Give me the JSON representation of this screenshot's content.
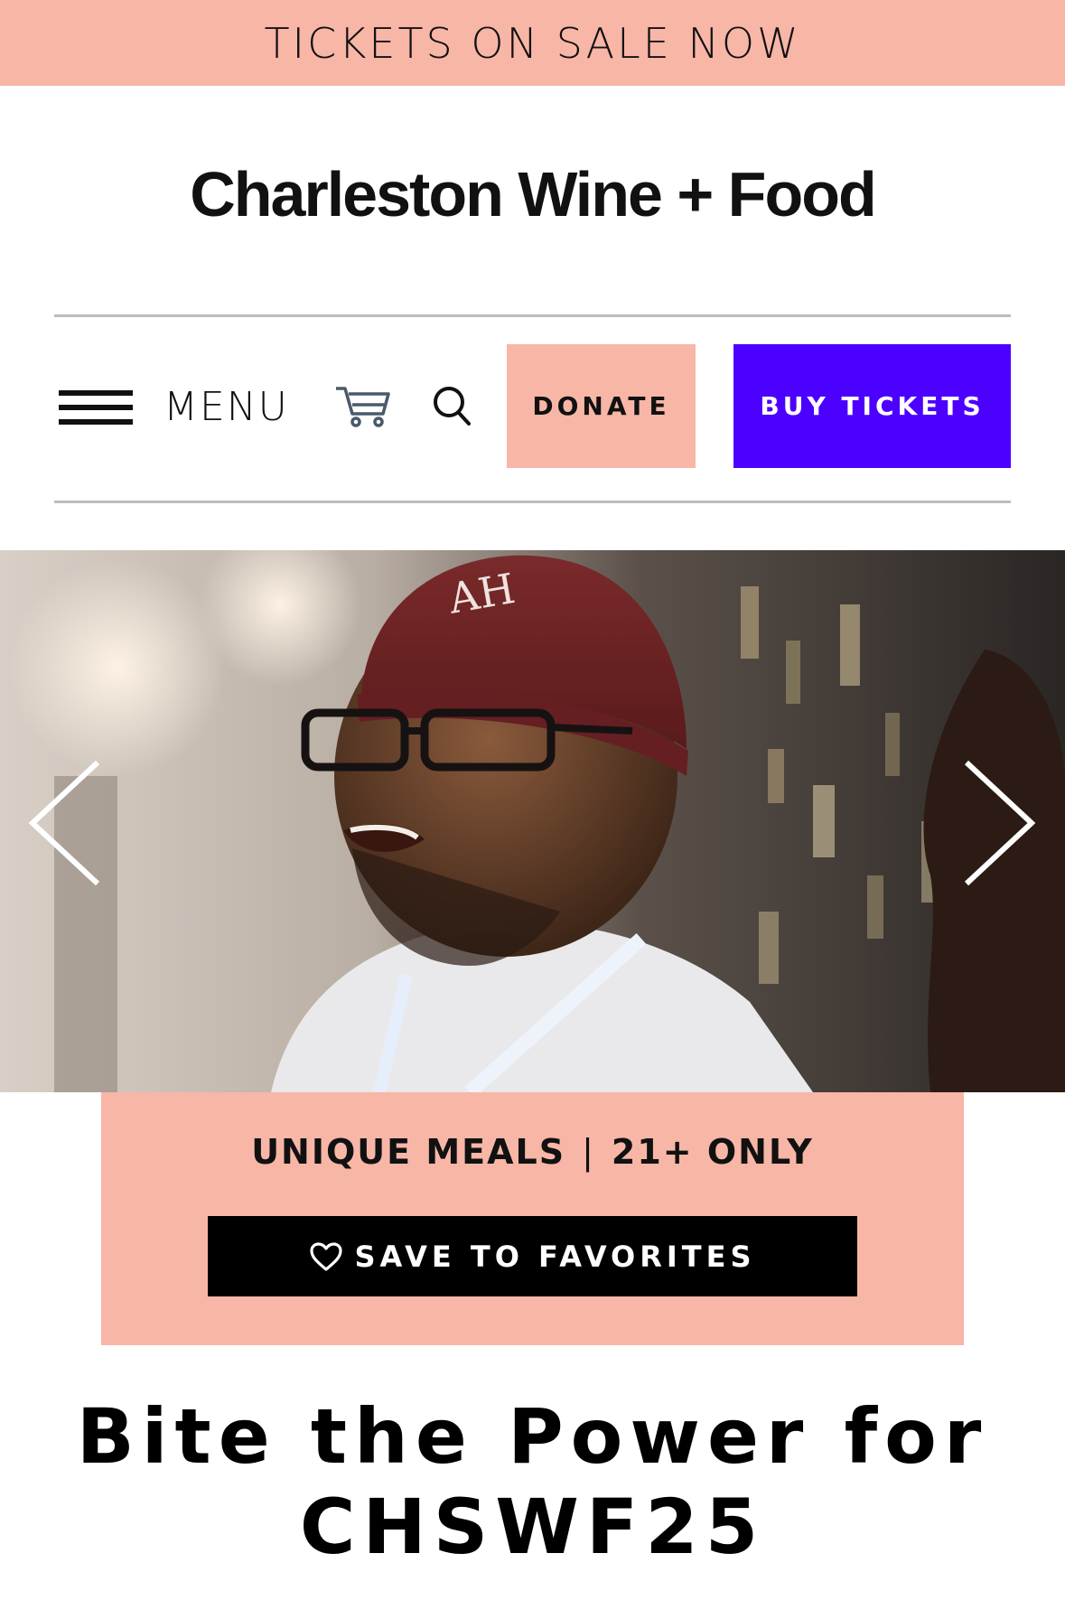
{
  "banner": {
    "text": "TICKETS ON SALE NOW"
  },
  "logo": {
    "text": "Charleston Wine + Food"
  },
  "nav": {
    "menu_label": "MENU",
    "donate_label": "DONATE",
    "buy_tickets_label": "BUY TICKETS",
    "icons": [
      "hamburger-icon",
      "cart-icon",
      "search-icon"
    ]
  },
  "hero": {
    "prev_icon": "chevron-left-icon",
    "next_icon": "chevron-right-icon"
  },
  "info": {
    "tag_1": "UNIQUE MEALS",
    "separator": "|",
    "tag_2": "21+ ONLY",
    "save_label": "SAVE TO FAVORITES",
    "save_icon": "heart-icon"
  },
  "event": {
    "title_line_1": "Bite the Power for",
    "title_line_2": "CHSWF25"
  },
  "colors": {
    "accent_pink": "#f8b6a7",
    "buy_button": "#4c00ff",
    "favorites_button": "#000000"
  }
}
